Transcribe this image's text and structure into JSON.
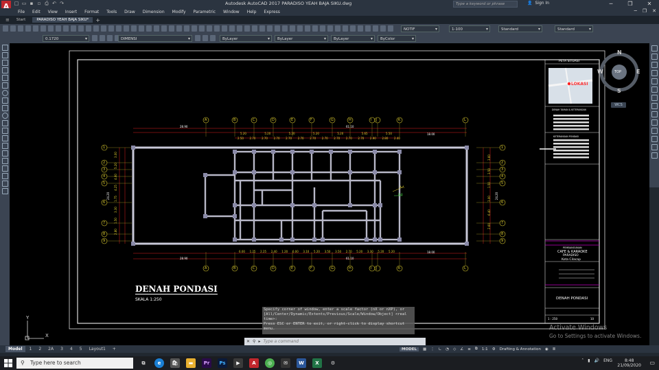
{
  "window": {
    "title": "Autodesk AutoCAD 2017    PARADISO YEAH BAJA SIKU.dwg",
    "search_placeholder": "Type a keyword or phrase",
    "signin": "Sign In"
  },
  "menu": [
    "File",
    "Edit",
    "View",
    "Insert",
    "Format",
    "Tools",
    "Draw",
    "Dimension",
    "Modify",
    "Parametric",
    "Window",
    "Help",
    "Express"
  ],
  "tabs": [
    {
      "label": "Start",
      "active": false
    },
    {
      "label": "PARADISO YEAH BAJA SIKU*",
      "active": true
    }
  ],
  "toolbar": {
    "text_style": "NOTIF",
    "dim_scale": "1-100",
    "style1": "Standard",
    "style2": "Standard",
    "layer_prefix": "0.1720",
    "layer": "DIMENSI",
    "color": "ByLayer",
    "linetype": "ByLayer",
    "lineweight": "ByLayer",
    "plotstyle": "ByColor"
  },
  "compass": {
    "n": "N",
    "s": "S",
    "e": "E",
    "w": "W",
    "top": "TOP",
    "wcs": "WCS"
  },
  "drawing": {
    "title": "DENAH PONDASI",
    "scale": "SKALA 1:250",
    "grid_top": [
      "A",
      "B",
      "C",
      "D",
      "E",
      "F",
      "G",
      "H",
      "I",
      "J",
      "K",
      "L"
    ],
    "grid_side": [
      "1",
      "2",
      "3",
      "4",
      "5",
      "6",
      "7",
      "8",
      "9"
    ],
    "dim_total": "61.10",
    "dim_left": "28.90",
    "dim_right": "18.00",
    "dims_top": [
      "5.20",
      "5.20",
      "5.20",
      "5.20",
      "5.20",
      "5.65",
      "5.50"
    ],
    "dims_top2": [
      "2.50",
      "2.70",
      "2.70",
      "2.70",
      "2.70",
      "2.70",
      "2.70",
      "2.70",
      "2.70",
      "2.70",
      "2.70",
      "2.90",
      "2.80",
      "2.40"
    ],
    "dims_bottom": [
      "6.00",
      "1.25",
      "2.25",
      "2.40",
      "1.20",
      "6.00",
      "3.10",
      "5.20",
      "3.50",
      "3.50",
      "2.70",
      "5.20",
      "3.30",
      "5.20",
      "5.20"
    ],
    "dims_left_side": [
      "3.00",
      "5.20",
      "4.00",
      "4.25",
      "1.75",
      "3.30",
      "1.50",
      "2.80"
    ],
    "dims_right_side": [
      "3.60",
      "3.50",
      "1.50",
      "3.00",
      "6.40",
      "2.60"
    ],
    "total_side": "24.20",
    "marker": "A-A",
    "marker2": "B-B"
  },
  "titleblock": {
    "map_header": "PETA SITUASI",
    "map_label": "LOKASI",
    "legend_a": "DENAH TAMAN & KETERANGAN",
    "legend_b": "KETERANGAN PONDASI",
    "project_label": "PEMBANGUNAN",
    "project_name": "CAFE & KARAOKE",
    "project_sub": "PARADISO",
    "project_city": "Kota Cilacap",
    "sheet_title": "DENAH PONDASI",
    "scale": "1 : 250",
    "sheet_no": "10"
  },
  "command": {
    "history": [
      "Specify corner of window, enter a scale factor (nX or nXP), or",
      "[All/Center/Dynamic/Extents/Previous/Scale/Window/Object] <real",
      "time>:",
      "Press ESC or ENTER to exit, or right-click to display shortcut",
      "menu."
    ],
    "placeholder": "Type a command"
  },
  "activation": {
    "line1": "Activate Windows",
    "line2": "Go to Settings to activate Windows."
  },
  "layout_tabs": [
    {
      "label": "Model",
      "active": true
    },
    {
      "label": "1",
      "active": false
    },
    {
      "label": "2",
      "active": false
    },
    {
      "label": "2A",
      "active": false
    },
    {
      "label": "3",
      "active": false
    },
    {
      "label": "4",
      "active": false
    },
    {
      "label": "5",
      "active": false
    },
    {
      "label": "Layout1",
      "active": false
    }
  ],
  "status": {
    "model": "MODEL",
    "annoscale": "1:1",
    "workspace": "Drafting & Annotation"
  },
  "taskbar": {
    "search": "Type here to search",
    "lang": "ENG",
    "time": "8:48",
    "date": "21/09/2020"
  },
  "colors": {
    "wall": "#c8c8d8",
    "dim_red": "#e02020",
    "grid_yellow": "#e0d030",
    "accent_magenta": "#c000c0"
  }
}
